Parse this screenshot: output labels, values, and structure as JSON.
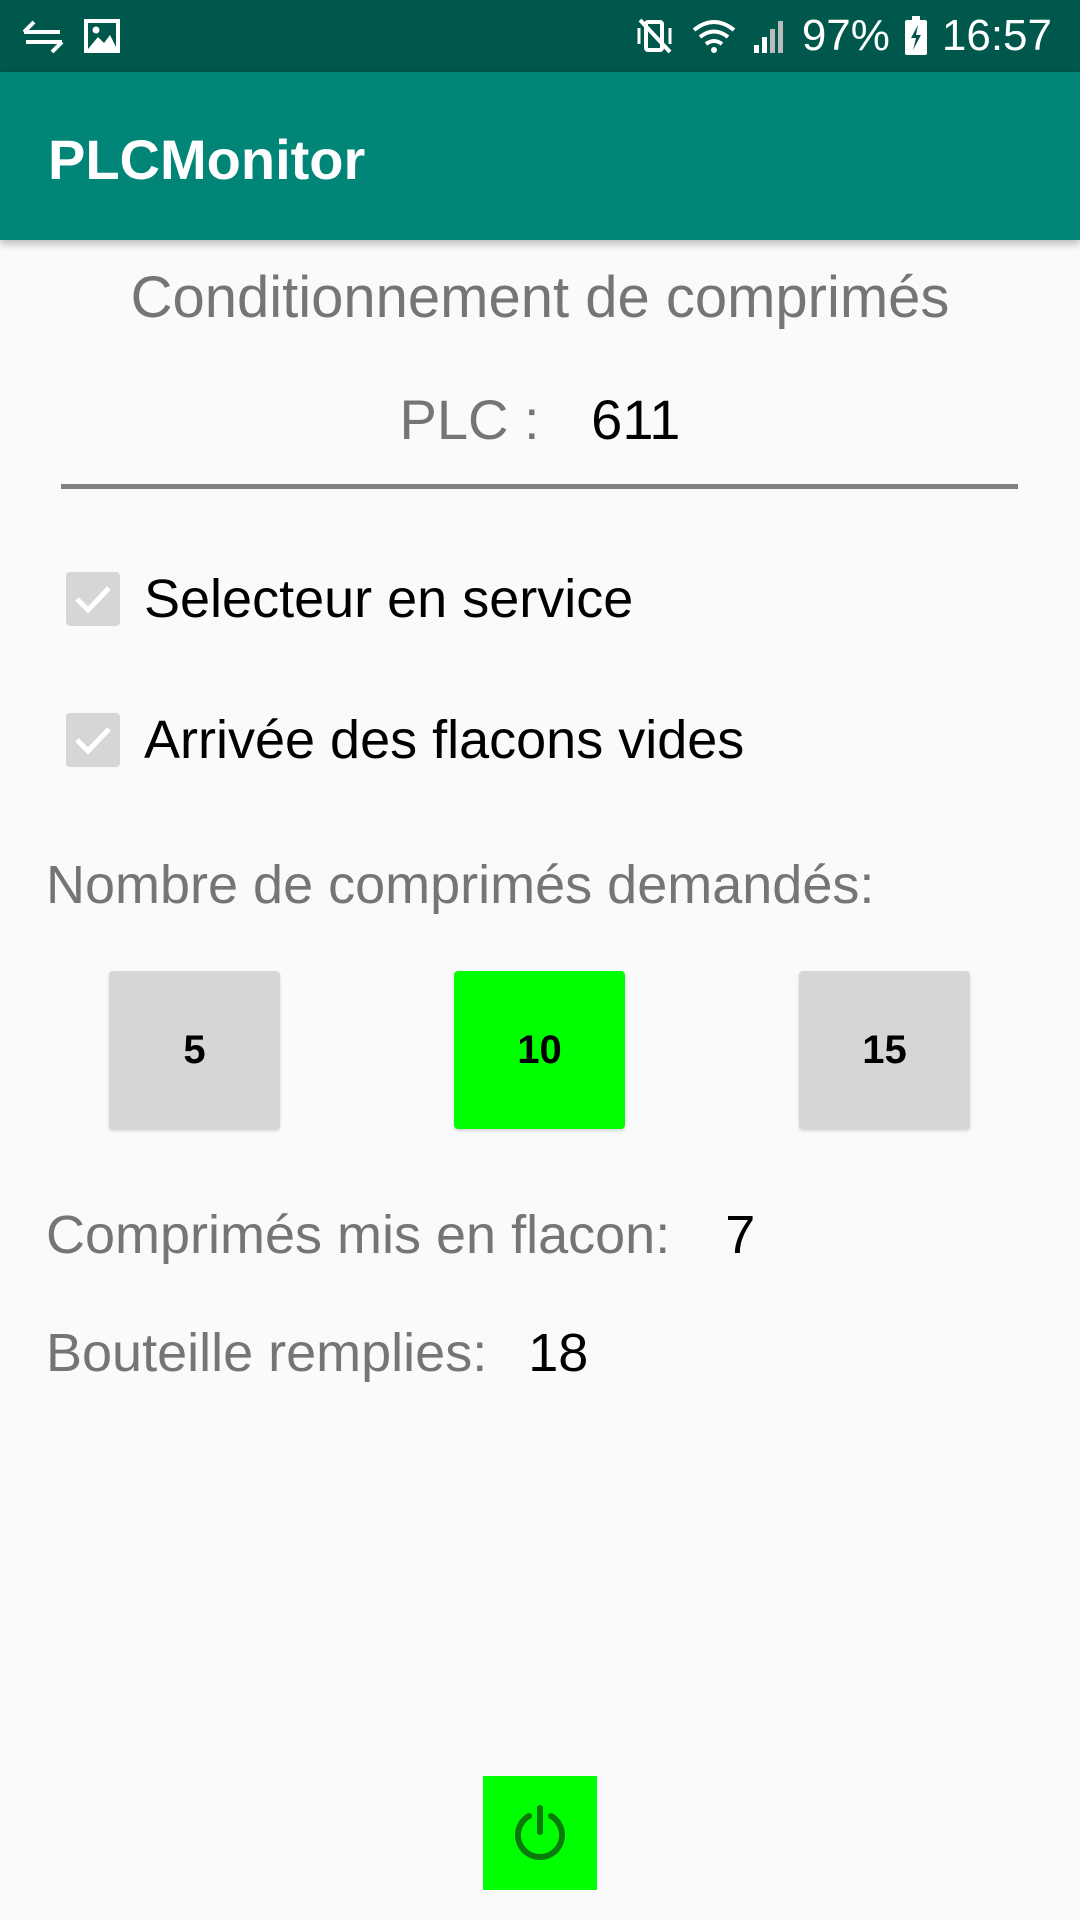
{
  "status_bar": {
    "left_icons": [
      "usb-transfer-icon",
      "image-icon"
    ],
    "right_icons": [
      "vibrate-mute-icon",
      "wifi-icon",
      "signal-icon",
      "battery-charging-icon"
    ],
    "battery": "97%",
    "time": "16:57"
  },
  "app_bar": {
    "title": "PLCMonitor"
  },
  "main": {
    "section_title": "Conditionnement de comprimés",
    "plc_label": "PLC :",
    "plc_value": "611",
    "checkboxes": [
      {
        "label": "Selecteur en service",
        "checked": true
      },
      {
        "label": "Arrivée des flacons vides",
        "checked": true
      }
    ],
    "requested_label": "Nombre de comprimés demandés:",
    "quantity_buttons": [
      {
        "label": "5",
        "active": false
      },
      {
        "label": "10",
        "active": true
      },
      {
        "label": "15",
        "active": false
      }
    ],
    "pills_filled_label": "Comprimés mis en flacon:",
    "pills_filled_value": "7",
    "bottles_filled_label": "Bouteille remplies:",
    "bottles_filled_value": "18",
    "power_icon": "power-icon"
  },
  "colors": {
    "status_bar": "#00574b",
    "app_bar": "#008577",
    "active_green": "#00ff00",
    "button_grey": "#d6d6d6",
    "secondary_text": "#757575"
  }
}
